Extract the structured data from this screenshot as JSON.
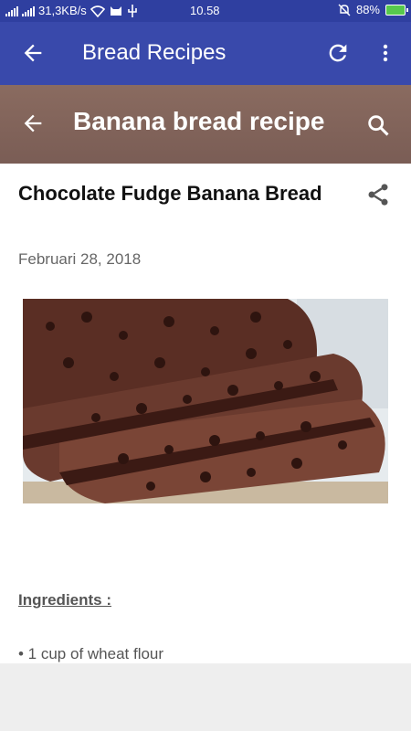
{
  "status_bar": {
    "speed": "31,3KB/s",
    "time": "10.58",
    "battery": "88%"
  },
  "app_bar": {
    "title": "Bread Recipes"
  },
  "post_header": {
    "title": "Banana bread recipe"
  },
  "post": {
    "title": "Chocolate Fudge Banana Bread",
    "date": "Februari 28, 2018",
    "section_heading": "Ingredients :",
    "items": [
      "• 1 cup of wheat flour"
    ]
  }
}
